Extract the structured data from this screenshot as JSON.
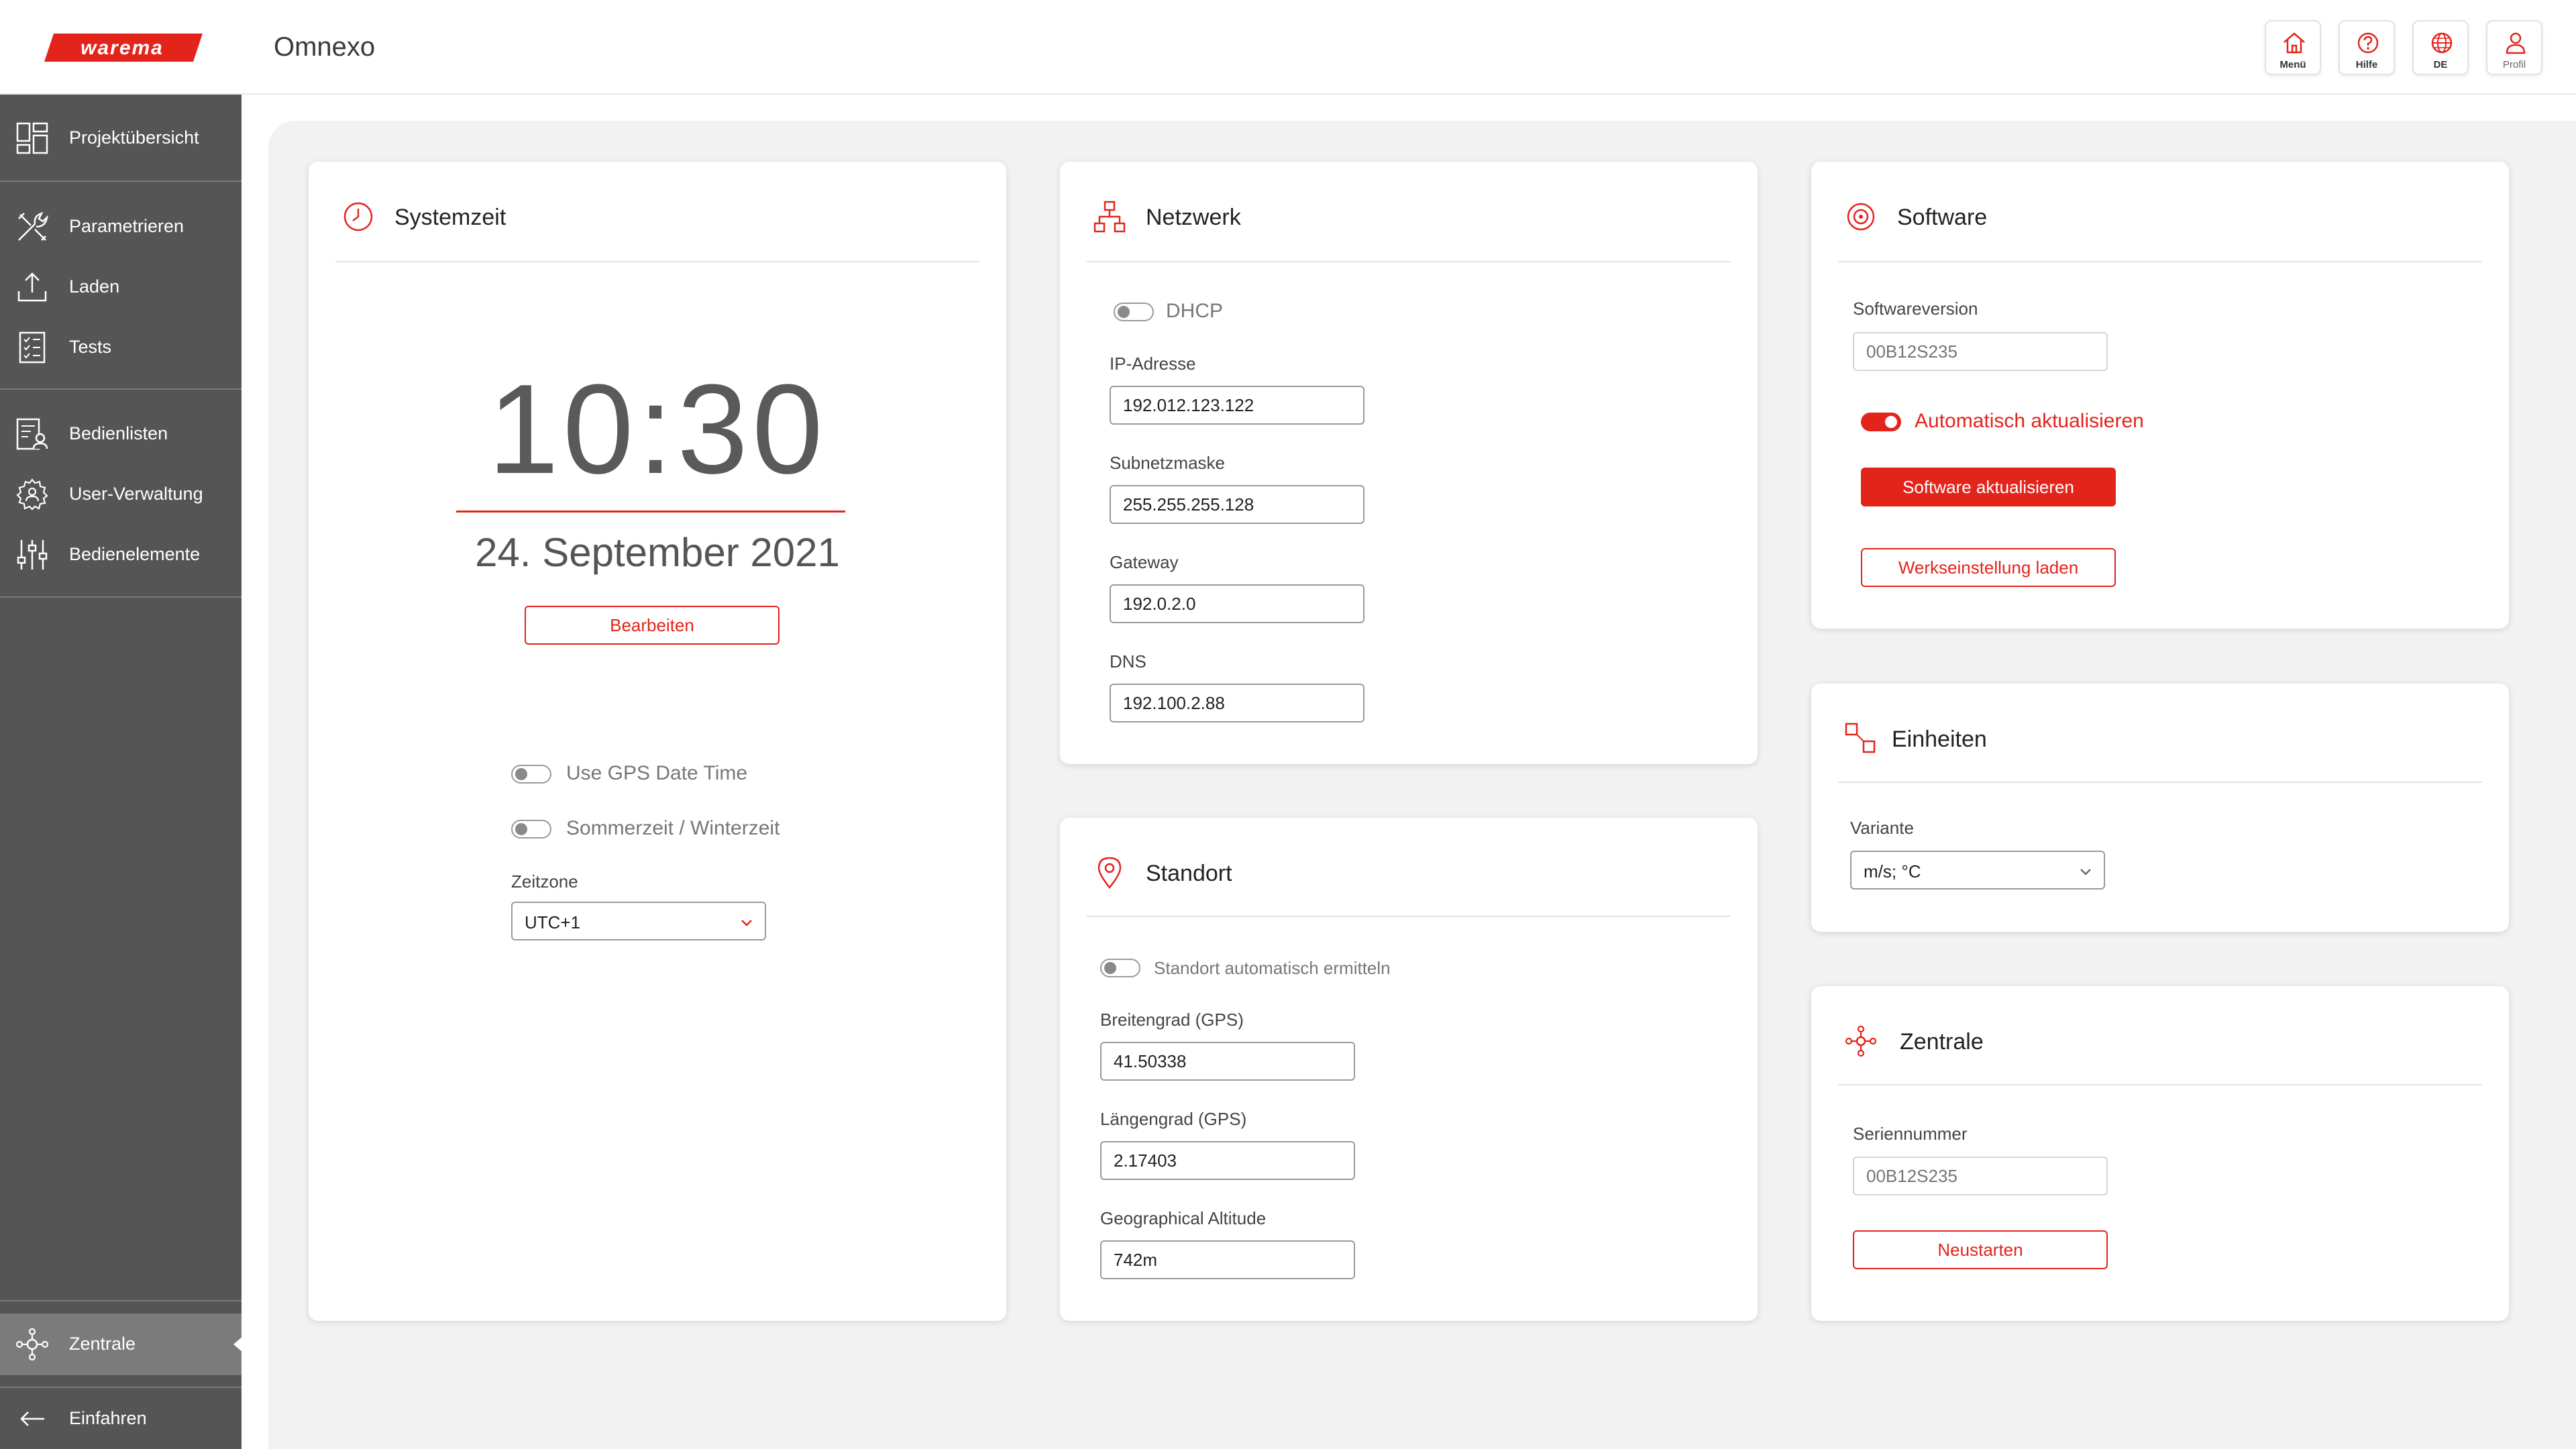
{
  "header": {
    "logo_text": "warema",
    "app_title": "Omnexo",
    "buttons": [
      {
        "label": "Menü",
        "icon": "home-icon"
      },
      {
        "label": "Hilfe",
        "icon": "help-icon"
      },
      {
        "label": "DE",
        "icon": "globe-icon"
      },
      {
        "label": "Profil",
        "icon": "user-icon"
      }
    ]
  },
  "sidebar": {
    "items": [
      {
        "label": "Projektübersicht",
        "icon": "dashboard-icon"
      },
      {
        "label": "Parametrieren",
        "icon": "tools-icon"
      },
      {
        "label": "Laden",
        "icon": "upload-icon"
      },
      {
        "label": "Tests",
        "icon": "checklist-icon"
      },
      {
        "label": "Bedienlisten",
        "icon": "user-list-icon"
      },
      {
        "label": "User-Verwaltung",
        "icon": "user-settings-icon"
      },
      {
        "label": "Bedienelemente",
        "icon": "sliders-icon"
      }
    ],
    "active_item": {
      "label": "Zentrale",
      "icon": "hub-icon"
    },
    "collapse": {
      "label": "Einfahren",
      "icon": "arrow-left-icon"
    }
  },
  "systemzeit": {
    "title": "Systemzeit",
    "time": "10:30",
    "date": "24. September 2021",
    "edit_button": "Bearbeiten",
    "gps_toggle": "Use GPS Date Time",
    "dst_toggle": "Sommerzeit / Winterzeit",
    "timezone_label": "Zeitzone",
    "timezone_value": "UTC+1"
  },
  "netzwerk": {
    "title": "Netzwerk",
    "dhcp_toggle": "DHCP",
    "ip_label": "IP-Adresse",
    "ip_value": "192.012.123.122",
    "subnet_label": "Subnetzmaske",
    "subnet_value": "255.255.255.128",
    "gateway_label": "Gateway",
    "gateway_value": "192.0.2.0",
    "dns_label": "DNS",
    "dns_value": "192.100.2.88"
  },
  "standort": {
    "title": "Standort",
    "auto_toggle": "Standort automatisch ermitteln",
    "lat_label": "Breitengrad (GPS)",
    "lat_value": "41.50338",
    "lon_label": "Längengrad (GPS)",
    "lon_value": "2.17403",
    "alt_label": "Geographical Altitude",
    "alt_value": "742m"
  },
  "software": {
    "title": "Software",
    "version_label": "Softwareversion",
    "version_placeholder": "00B12S235",
    "auto_update_toggle": "Automatisch aktualisieren",
    "update_button": "Software aktualisieren",
    "factory_button": "Werkseinstellung laden"
  },
  "einheiten": {
    "title": "Einheiten",
    "variant_label": "Variante",
    "variant_value": "m/s; °C"
  },
  "zentrale": {
    "title": "Zentrale",
    "serial_label": "Seriennummer",
    "serial_placeholder": "00B12S235",
    "restart_button": "Neustarten"
  },
  "colors": {
    "accent": "#e3241b",
    "sidebar_bg": "#555555",
    "sidebar_active": "#7b7b7b",
    "main_bg": "#f2f2f2"
  }
}
